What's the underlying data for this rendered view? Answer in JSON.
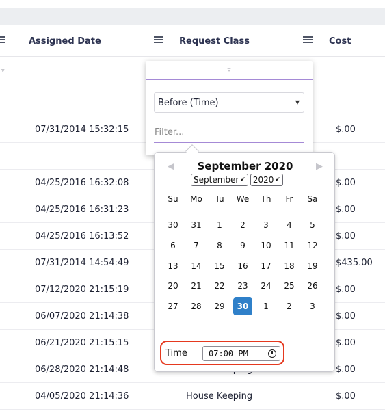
{
  "header": {
    "col_assigned": "Assigned Date",
    "col_request_class": "Request Class",
    "col_cost": "Cost"
  },
  "rows": [
    {
      "date": "",
      "class": "",
      "cost": ""
    },
    {
      "date": "07/31/2014 15:32:15",
      "class": "",
      "cost": "$.00"
    },
    {
      "date": "",
      "class": "",
      "cost": ""
    },
    {
      "date": "04/25/2016 16:32:08",
      "class": "",
      "cost": "$.00"
    },
    {
      "date": "04/25/2016 16:31:23",
      "class": "",
      "cost": "$.00"
    },
    {
      "date": "04/25/2016 16:13:52",
      "class": "",
      "cost": "$.00"
    },
    {
      "date": "07/31/2014 14:54:49",
      "class": "",
      "cost": "$435.00"
    },
    {
      "date": "07/12/2020 21:15:19",
      "class": "",
      "cost": "$.00"
    },
    {
      "date": "06/07/2020 21:14:38",
      "class": "",
      "cost": "$.00"
    },
    {
      "date": "06/21/2020 21:15:15",
      "class": "",
      "cost": "$.00"
    },
    {
      "date": "06/28/2020 21:14:48",
      "class": "House Keeping",
      "cost": "$.00"
    },
    {
      "date": "04/05/2020 21:14:36",
      "class": "House Keeping",
      "cost": "$.00"
    }
  ],
  "filter_popup": {
    "operator": "Before (Time)",
    "placeholder": "Filter..."
  },
  "datepicker": {
    "title": "September 2020",
    "month_select": "September",
    "year_select": "2020",
    "weekdays": [
      "Su",
      "Mo",
      "Tu",
      "We",
      "Th",
      "Fr",
      "Sa"
    ],
    "weeks": [
      [
        "30",
        "31",
        "1",
        "2",
        "3",
        "4",
        "5"
      ],
      [
        "6",
        "7",
        "8",
        "9",
        "10",
        "11",
        "12"
      ],
      [
        "13",
        "14",
        "15",
        "16",
        "17",
        "18",
        "19"
      ],
      [
        "20",
        "21",
        "22",
        "23",
        "24",
        "25",
        "26"
      ],
      [
        "27",
        "28",
        "29",
        "30",
        "1",
        "2",
        "3"
      ]
    ],
    "selected_day": "30",
    "time_label": "Time",
    "time_value": "07:00 PM"
  },
  "colors": {
    "accent": "#a58ad6",
    "selected": "#2f80c9",
    "highlight": "#e5391f"
  }
}
